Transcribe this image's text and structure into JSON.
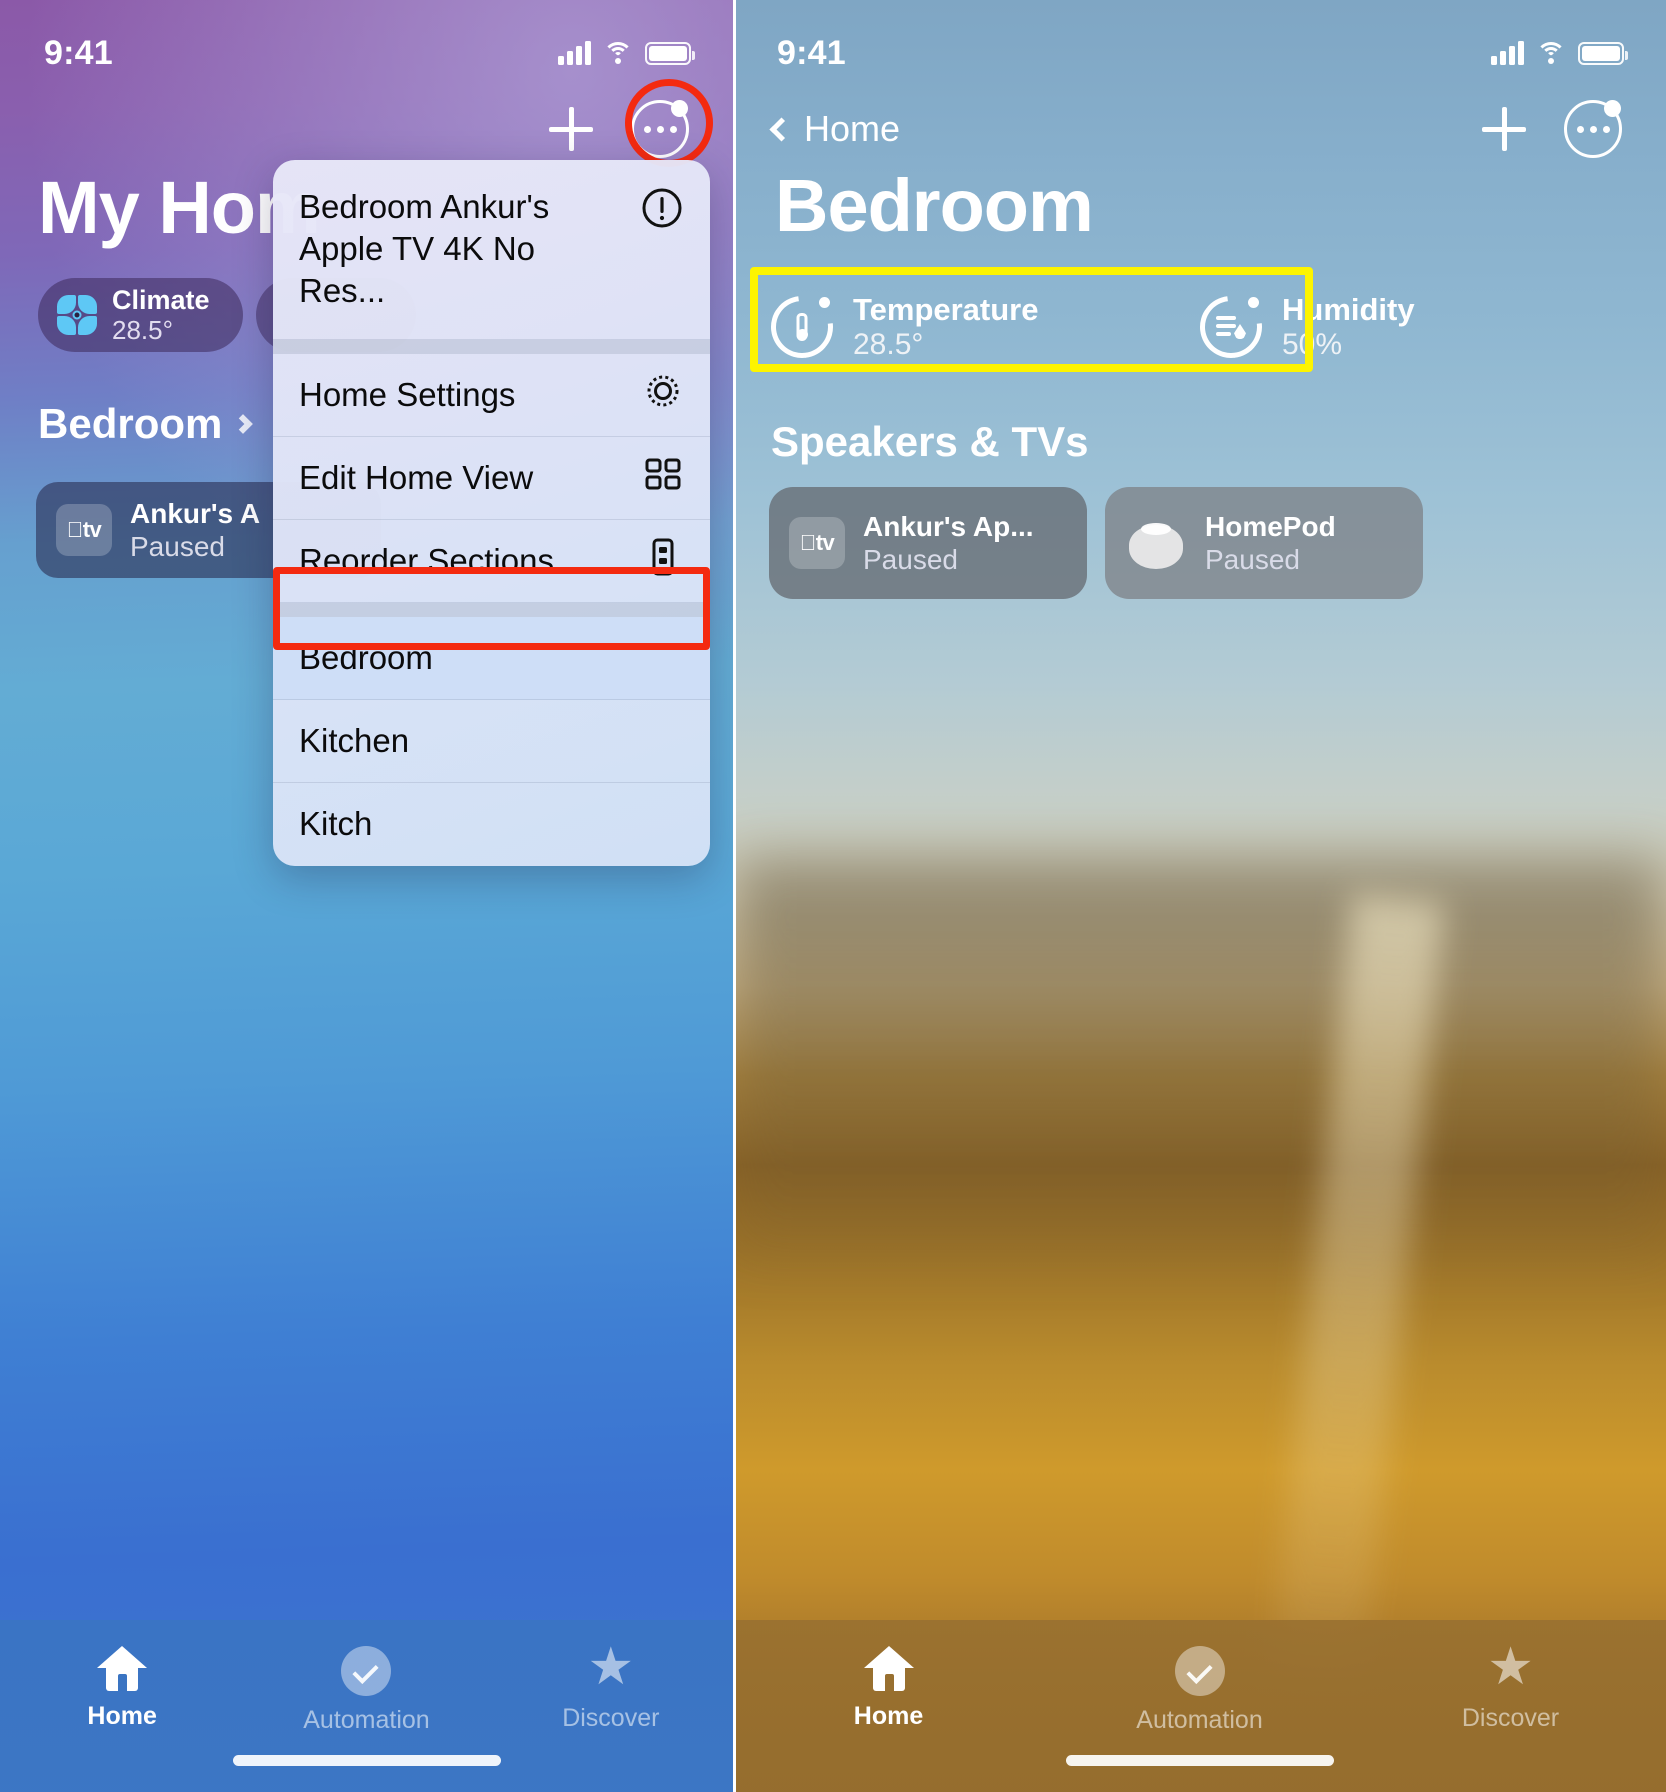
{
  "left_phone": {
    "status_bar": {
      "time": "9:41",
      "signal_icon": "cellular-bars-icon",
      "wifi_icon": "wifi-icon",
      "battery_icon": "battery-icon"
    },
    "nav": {
      "add_label": "+",
      "more_icon": "ellipsis-circle-icon"
    },
    "title": "My Hom",
    "climate_tile": {
      "name": "Climate",
      "value": "28.5°",
      "icon": "fan-icon"
    },
    "room_header": {
      "label": "Bedroom",
      "chevron": "chevron-right-icon"
    },
    "accessory_card": {
      "badge": "tv",
      "title": "Ankur's A",
      "status": "Paused"
    },
    "context_menu": {
      "items": [
        {
          "label": "Bedroom Ankur's Apple TV 4K No Res...",
          "icon": "exclamation-circle-icon"
        },
        {
          "label": "Home Settings",
          "icon": "gear-icon"
        },
        {
          "label": "Edit Home View",
          "icon": "grid-squares-icon"
        },
        {
          "label": "Reorder Sections",
          "icon": "reorder-list-icon"
        },
        {
          "label": "Bedroom",
          "icon": ""
        },
        {
          "label": "Kitchen",
          "icon": ""
        },
        {
          "label": "Kitch",
          "icon": ""
        }
      ],
      "selected_label": "Bedroom"
    },
    "tabs": [
      {
        "label": "Home",
        "icon": "house-icon",
        "active": true
      },
      {
        "label": "Automation",
        "icon": "automation-check-icon",
        "active": false
      },
      {
        "label": "Discover",
        "icon": "star-icon",
        "active": false
      }
    ]
  },
  "right_phone": {
    "status_bar": {
      "time": "9:41",
      "signal_icon": "cellular-bars-icon",
      "wifi_icon": "wifi-icon",
      "battery_icon": "battery-icon"
    },
    "nav": {
      "back_label": "Home",
      "back_icon": "chevron-left-icon",
      "add_label": "+",
      "more_icon": "ellipsis-circle-icon"
    },
    "title": "Bedroom",
    "sensors": [
      {
        "label": "Temperature",
        "value": "28.5°",
        "icon": "thermometer-gauge-icon"
      },
      {
        "label": "Humidity",
        "value": "50%",
        "icon": "humidity-gauge-icon"
      }
    ],
    "section_title": "Speakers & TVs",
    "tiles": [
      {
        "title": "Ankur's Ap...",
        "status": "Paused",
        "icon": "apple-tv-icon"
      },
      {
        "title": "HomePod",
        "status": "Paused",
        "icon": "homepod-icon"
      }
    ],
    "tabs": [
      {
        "label": "Home",
        "icon": "house-icon",
        "active": true
      },
      {
        "label": "Automation",
        "icon": "automation-check-icon",
        "active": false
      },
      {
        "label": "Discover",
        "icon": "star-icon",
        "active": false
      }
    ]
  },
  "annotations": {
    "red_color": "#f42a10",
    "yellow_color": "#fdf400",
    "red_circle_target": "more-button",
    "red_box_target": "menu-item-bedroom",
    "yellow_box_target": "sensor-row"
  }
}
